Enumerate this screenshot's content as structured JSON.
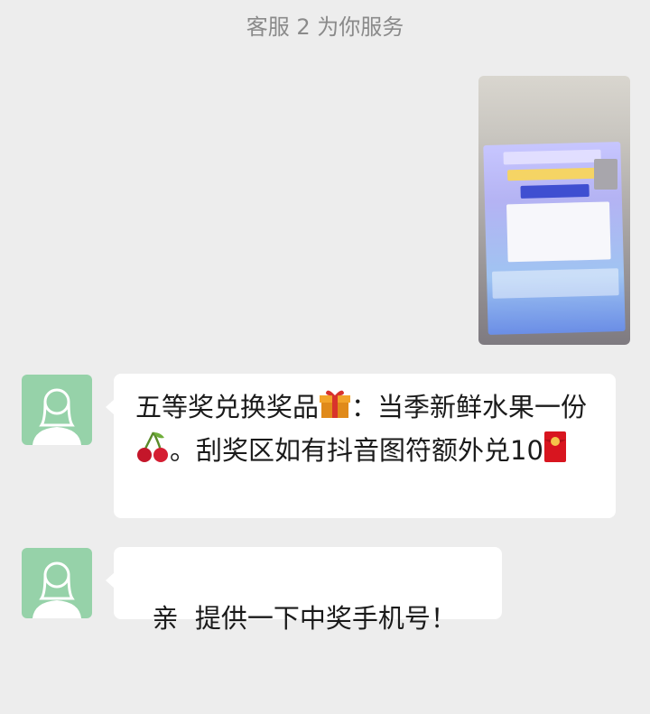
{
  "header": {
    "title": "客服 2 为你服务"
  },
  "messages": [
    {
      "segments": [
        "五等奖兑换奖品",
        "：当季新鲜水果一份",
        "。刮奖区如有抖音图符额外兑10"
      ],
      "emojis": [
        "gift-icon",
        "cherry-icon",
        "red-envelope-icon"
      ]
    },
    {
      "text": "亲  提供一下中奖手机号！"
    }
  ],
  "colors": {
    "background": "#ededed",
    "bubble": "#ffffff",
    "avatar": "#96d2a9",
    "header_text": "#8a8a8a"
  }
}
